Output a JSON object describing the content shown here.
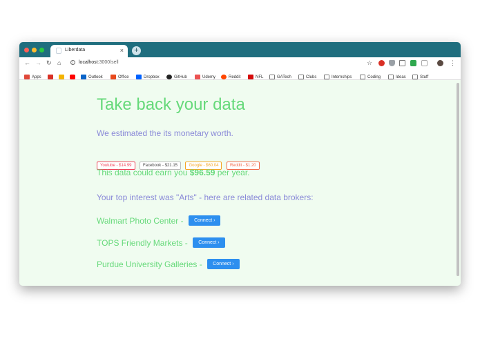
{
  "browser": {
    "tab_title": "Liberdata",
    "tab_close": "×",
    "new_tab": "+",
    "nav": {
      "back": "←",
      "forward": "→",
      "reload": "↻",
      "home": "⌂"
    },
    "url_host": "localhost",
    "url_path": ":3000/sell",
    "toolbar_icons": [
      "star-icon",
      "adblock-icon",
      "shield-icon",
      "cast-icon",
      "extension-icon",
      "puzzle-icon",
      "profile-avatar",
      "menu-icon"
    ],
    "bookmarks": [
      {
        "label": "Apps",
        "icon": "apps-grid-icon",
        "color": "#e0483a"
      },
      {
        "label": "",
        "icon": "gmail-icon",
        "color": "#d93025"
      },
      {
        "label": "",
        "icon": "drive-icon",
        "color": "#f4b400"
      },
      {
        "label": "",
        "icon": "youtube-icon",
        "color": "#ff0000"
      },
      {
        "label": "Outlook",
        "icon": "outlook-icon",
        "color": "#0a64c8"
      },
      {
        "label": "Office",
        "icon": "office-icon",
        "color": "#e8491d"
      },
      {
        "label": "Dropbox",
        "icon": "dropbox-icon",
        "color": "#0061ff"
      },
      {
        "label": "GitHub",
        "icon": "github-icon",
        "color": "#222222"
      },
      {
        "label": "Udemy",
        "icon": "udemy-icon",
        "color": "#ec5252"
      },
      {
        "label": "Reddit",
        "icon": "reddit-icon",
        "color": "#ff4500"
      },
      {
        "label": "NFL",
        "icon": "nfl-icon",
        "color": "#d50a0a"
      },
      {
        "label": "GATech",
        "icon": "folder-icon",
        "color": "#777777"
      },
      {
        "label": "Clubs",
        "icon": "folder-icon",
        "color": "#777777"
      },
      {
        "label": "Internships",
        "icon": "folder-icon",
        "color": "#777777"
      },
      {
        "label": "Coding",
        "icon": "folder-icon",
        "color": "#777777"
      },
      {
        "label": "Ideas",
        "icon": "folder-icon",
        "color": "#777777"
      },
      {
        "label": "Stuff",
        "icon": "folder-icon",
        "color": "#777777"
      }
    ]
  },
  "page": {
    "title": "Take back your data",
    "subtitle": "We estimated the its monetary worth.",
    "estimates": [
      {
        "label": "Youtube - $14.99",
        "color": "#f0435a"
      },
      {
        "label": "Facebook - $21.15",
        "color": "#444444"
      },
      {
        "label": "Google - $60.04",
        "color": "#f5a623"
      },
      {
        "label": "Reddit - $1.20",
        "color": "#f26b4c"
      }
    ],
    "earn_prefix": "This data could earn you ",
    "earn_amount": "$96.59",
    "earn_suffix": " per year.",
    "interest_text": "Your top interest was \"Arts\" - here are related data brokers:",
    "brokers": [
      {
        "name": "Walmart Photo Center -",
        "button": "Connect  ›"
      },
      {
        "name": "TOPS Friendly Markets -",
        "button": "Connect  ›"
      },
      {
        "name": "Purdue University Galleries -",
        "button": "Connect  ›"
      }
    ]
  },
  "colors": {
    "accent_green": "#66d97a",
    "accent_purple": "#8a8ad8",
    "button_blue": "#2d8fef",
    "titlebar": "#1f6e7e"
  }
}
